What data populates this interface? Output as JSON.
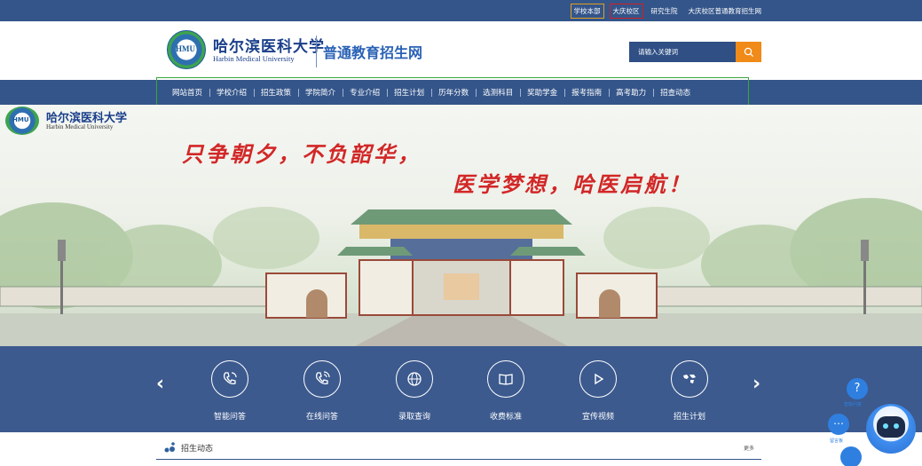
{
  "top_links": [
    "学校本部",
    "大庆校区",
    "研究生院",
    "大庆校区普通教育招生网"
  ],
  "header": {
    "uni_name_cn": "哈尔滨医科大学",
    "uni_name_en": "Harbin Medical University",
    "site_title": "普通教育招生网",
    "logo_text": "HMU"
  },
  "search": {
    "placeholder": "请输入关键词"
  },
  "nav": [
    "网站首页",
    "学校介绍",
    "招生政策",
    "学院简介",
    "专业介绍",
    "招生计划",
    "历年分数",
    "选测科目",
    "奖助学金",
    "报考指南",
    "高考助力",
    "招查动态"
  ],
  "banner": {
    "logo_text": "HMU",
    "uni_cn": "哈尔滨医科大学",
    "uni_en": "Harbin Medical University",
    "slogan_line1": "只争朝夕，不负韶华，",
    "slogan_line2": "医学梦想，哈医启航！"
  },
  "functions": [
    {
      "label": "智能问答",
      "icon": "phone-call-icon"
    },
    {
      "label": "在线问答",
      "icon": "phone-wave-icon"
    },
    {
      "label": "录取查询",
      "icon": "search-globe-icon"
    },
    {
      "label": "收费标准",
      "icon": "book-icon"
    },
    {
      "label": "宣传视频",
      "icon": "play-icon"
    },
    {
      "label": "招生计划",
      "icon": "world-map-icon"
    }
  ],
  "news": {
    "title": "招生动态",
    "more": "更多"
  },
  "float": {
    "help_label": "智能问答",
    "msg_label": "留言板"
  },
  "colors": {
    "nav_blue": "#34558a",
    "accent_orange": "#f08a18",
    "slogan_red": "#d22727"
  }
}
